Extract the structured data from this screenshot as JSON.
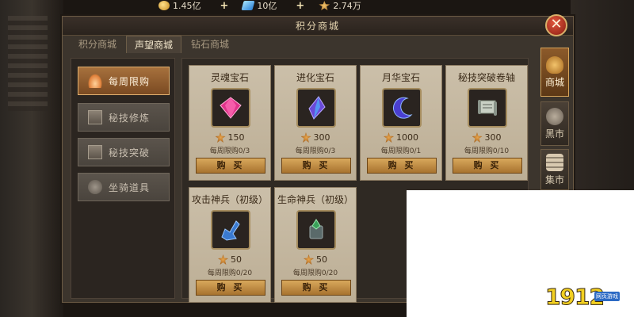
{
  "resources": [
    {
      "icon": "gold-coin-icon",
      "value": "1.45亿"
    },
    {
      "icon": "diamond-icon",
      "value": "10亿"
    },
    {
      "icon": "prestige-medal-icon",
      "value": "2.74万"
    }
  ],
  "window": {
    "title": "积分商城",
    "close_label": "✕"
  },
  "tabs": [
    {
      "label": "积分商城",
      "active": false
    },
    {
      "label": "声望商城",
      "active": true
    },
    {
      "label": "钻石商城",
      "active": false
    }
  ],
  "categories": [
    {
      "label": "每周限购",
      "icon": "fire-icon",
      "active": true
    },
    {
      "label": "秘技修炼",
      "icon": "book-icon",
      "active": false
    },
    {
      "label": "秘技突破",
      "icon": "book-icon",
      "active": false
    },
    {
      "label": "坐骑道具",
      "icon": "mount-icon",
      "active": false
    }
  ],
  "items": [
    {
      "name": "灵魂宝石",
      "price": "150",
      "limit": "每周限购0/3",
      "buy": "购 买",
      "color": "#e0338a"
    },
    {
      "name": "进化宝石",
      "price": "300",
      "limit": "每周限购0/3",
      "buy": "购 买",
      "color": "#6a4ad8"
    },
    {
      "name": "月华宝石",
      "price": "1000",
      "limit": "每周限购0/1",
      "buy": "购 买",
      "color": "#4a3fd0"
    },
    {
      "name": "秘技突破卷轴",
      "price": "300",
      "limit": "每周限购0/10",
      "buy": "购 买",
      "color": "#9aa89a"
    },
    {
      "name": "攻击神兵（初级）",
      "price": "50",
      "limit": "每周限购0/20",
      "buy": "购 买",
      "color": "#3a7ad0"
    },
    {
      "name": "生命神兵（初级）",
      "price": "50",
      "limit": "每周限购0/20",
      "buy": "购 买",
      "color": "#3aa05a"
    }
  ],
  "side_tabs": [
    {
      "label": "商城",
      "icon": "money-bag-icon",
      "active": true
    },
    {
      "label": "黑市",
      "icon": "merchant-icon",
      "active": false
    },
    {
      "label": "集市",
      "icon": "coin-stack-icon",
      "active": false
    }
  ],
  "watermark": {
    "brand": "1912",
    "sub": "网页游戏"
  }
}
